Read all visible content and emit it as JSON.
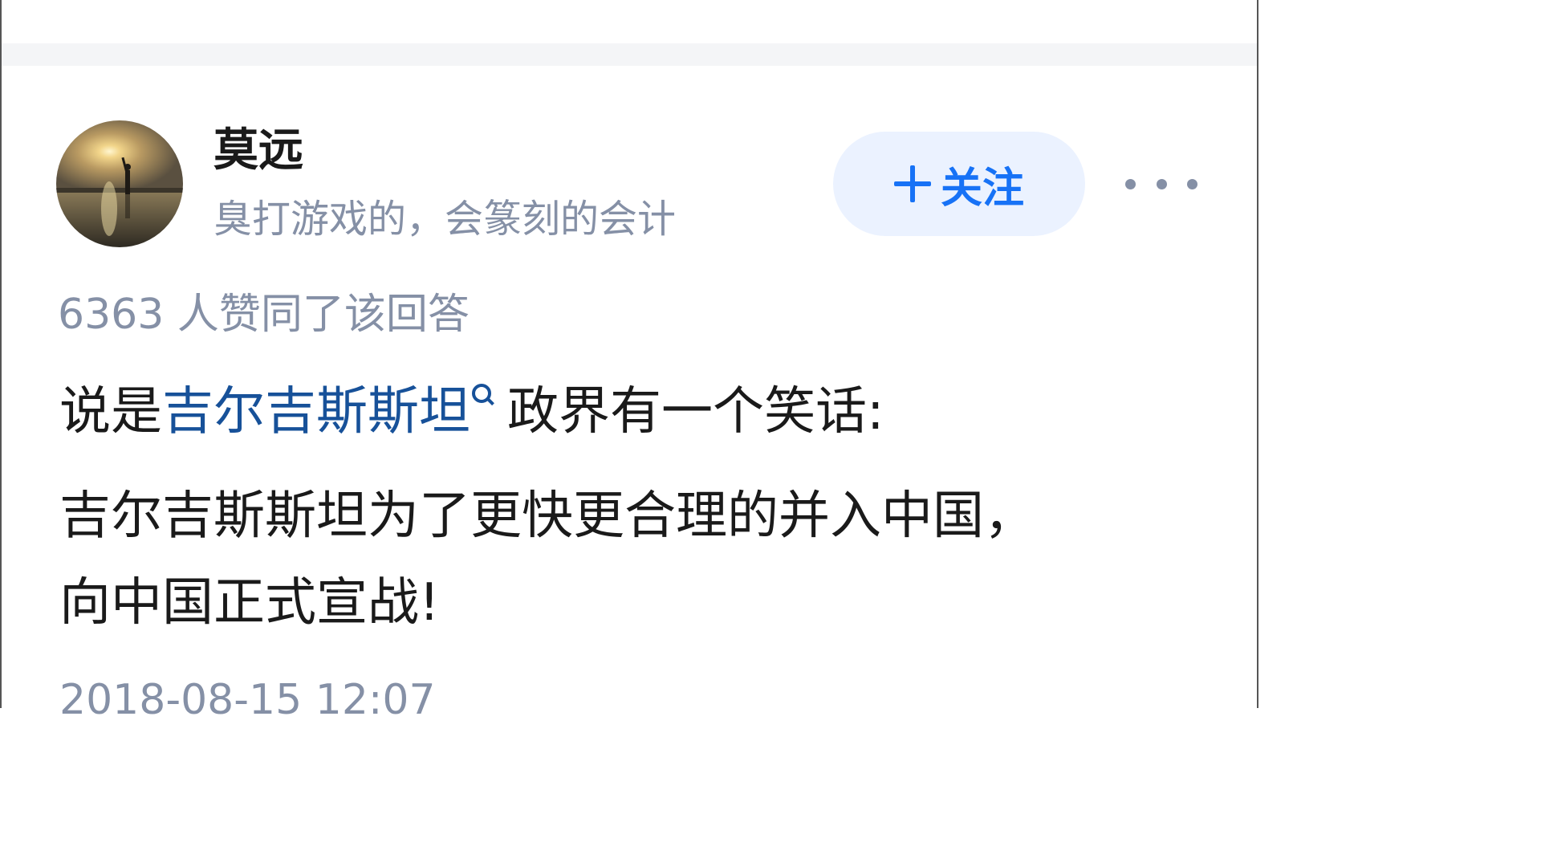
{
  "author": {
    "name": "莫远",
    "bio": "臭打游戏的，会篆刻的会计"
  },
  "actions": {
    "follow_label": "关注",
    "follow_icon": "plus-icon",
    "more_icon": "more-icon"
  },
  "answer": {
    "vote_text": "6363 人赞同了该回答",
    "line1_prefix": "说是",
    "line1_link": "吉尔吉斯斯坦",
    "line1_suffix": "政界有一个笑话:",
    "line2": "吉尔吉斯斯坦为了更快更合理的并入中国，",
    "line3": "向中国正式宣战!",
    "timestamp": "2018-08-15 12:07"
  },
  "colors": {
    "link": "#175199",
    "accent": "#1772f6",
    "follow_bg": "#ebf2ff",
    "muted": "#8590a6",
    "text": "#1a1a1a",
    "separator": "#f4f5f7"
  }
}
